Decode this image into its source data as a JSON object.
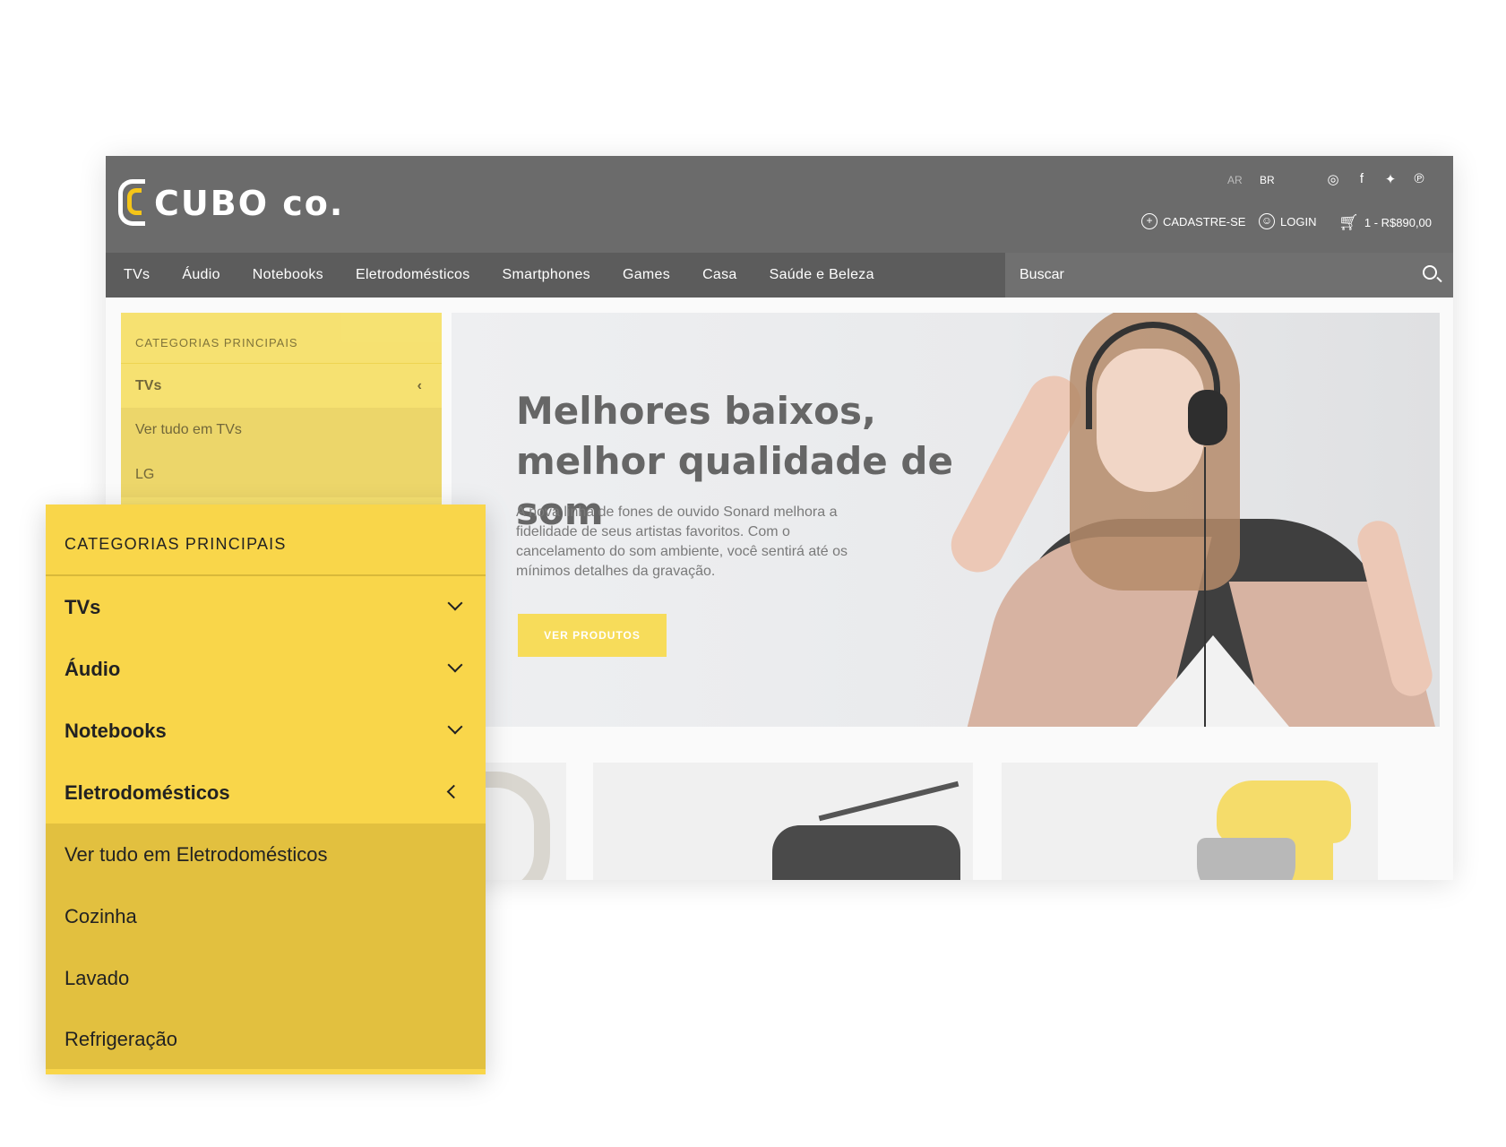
{
  "header": {
    "logo_text": "CUBO co.",
    "languages": [
      "AR",
      "BR"
    ],
    "socials": [
      "instagram-icon",
      "facebook-icon",
      "twitter-icon",
      "pinterest-icon"
    ],
    "register_label": "CADASTRE-SE",
    "login_label": "LOGIN",
    "cart_label": "1 - R$890,00"
  },
  "nav": {
    "items": [
      "TVs",
      "Áudio",
      "Notebooks",
      "Eletrodomésticos",
      "Smartphones",
      "Games",
      "Casa",
      "Saúde e Beleza"
    ],
    "search_placeholder": "Buscar"
  },
  "sidebar": {
    "title": "CATEGORIAS PRINCIPAIS",
    "active": "TVs",
    "sub_items": [
      "Ver tudo em TVs",
      "LG"
    ]
  },
  "hero": {
    "title": "Melhores baixos, melhor qualidade de som",
    "text": "A nova linha de fones de ouvido Sonard melhora a fidelidade de seus artistas favoritos. Com o cancelamento do som ambiente, você sentirá até os mínimos detalhes da gravação.",
    "button_label": "VER PRODUTOS"
  },
  "menu": {
    "title": "CATEGORIAS PRINCIPAIS",
    "items": [
      "TVs",
      "Áudio",
      "Notebooks",
      "Eletrodomésticos"
    ],
    "sub_items": [
      "Ver tudo em Eletrodomésticos",
      "Cozinha",
      "Lavado",
      "Refrigeração"
    ]
  },
  "colors": {
    "topbar": "#6b6b6b",
    "navbar": "#5c5c5c",
    "menu_yellow": "#f9d64a",
    "submenu_yellow": "#e2c03f",
    "accent": "#f5c518"
  }
}
